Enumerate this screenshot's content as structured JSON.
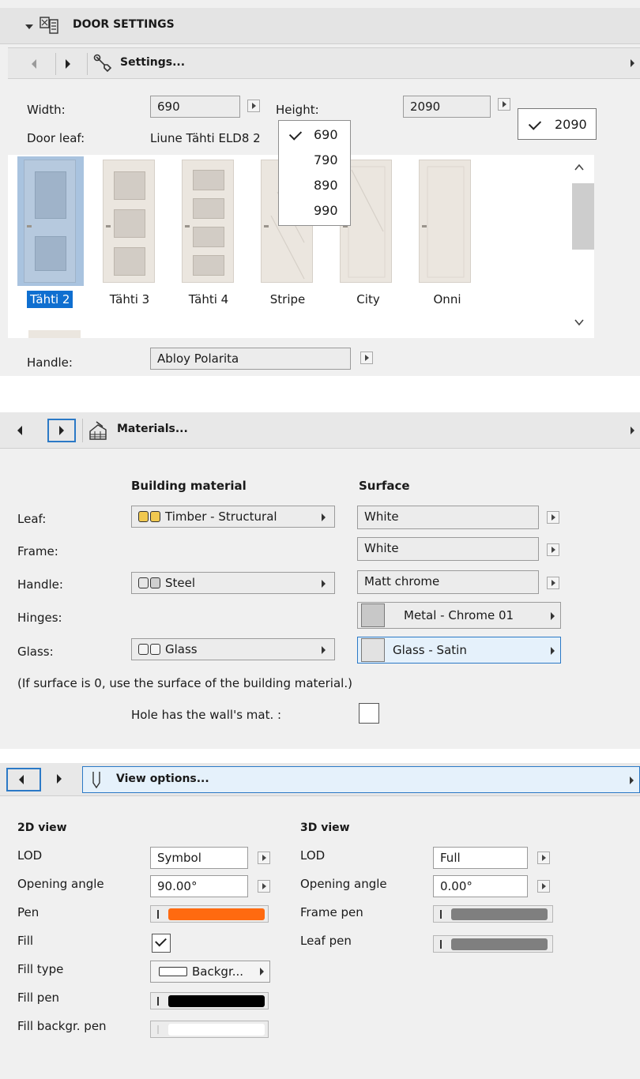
{
  "header": {
    "title": "DOOR SETTINGS",
    "settings_label": "Settings..."
  },
  "door": {
    "width_label": "Width:",
    "width_value": "690",
    "height_label": "Height:",
    "height_value": "2090",
    "height_tooltip": "2090",
    "door_leaf_label": "Door leaf:",
    "door_leaf_value": "Liune Tähti ELD8 2",
    "width_options": [
      "690",
      "790",
      "890",
      "990"
    ],
    "gallery": [
      "Tähti 2",
      "Tähti 3",
      "Tähti 4",
      "Stripe",
      "City",
      "Onni"
    ],
    "handle_label": "Handle:",
    "handle_value": "Abloy Polarita"
  },
  "materials": {
    "title": "Materials...",
    "col_building": "Building material",
    "col_surface": "Surface",
    "rows": [
      {
        "label": "Leaf:",
        "building": "Timber - Structural",
        "surface": "White"
      },
      {
        "label": "Frame:",
        "building": "",
        "surface": "White"
      },
      {
        "label": "Handle:",
        "building": "Steel",
        "surface": "Matt chrome"
      },
      {
        "label": "Hinges:",
        "building": "",
        "surface": "Metal - Chrome 01"
      },
      {
        "label": "Glass:",
        "building": "Glass",
        "surface": "Glass - Satin"
      }
    ],
    "note": "(If surface is 0, use the surface of the building material.)",
    "hole_label": "Hole has the wall's mat. :"
  },
  "view": {
    "title": "View options...",
    "2d_title": "2D view",
    "3d_title": "3D view",
    "lod_label": "LOD",
    "lod_2d": "Symbol",
    "lod_3d": "Full",
    "opening_label": "Opening angle",
    "opening_2d": "90.00°",
    "opening_3d": "0.00°",
    "pen_label": "Pen",
    "fill_label": "Fill",
    "fill_type_label": "Fill type",
    "fill_type_value": "Backgr...",
    "fill_pen_label": "Fill pen",
    "fill_backgr_label": "Fill backgr. pen",
    "frame_pen_label": "Frame pen",
    "leaf_pen_label": "Leaf pen",
    "pen_color": "#ff6a10",
    "fill_pen_color": "#000000",
    "frame_pen_color": "#7f7f7f",
    "leaf_pen_color": "#7f7f7f",
    "selection_color": "#2b79c6"
  }
}
